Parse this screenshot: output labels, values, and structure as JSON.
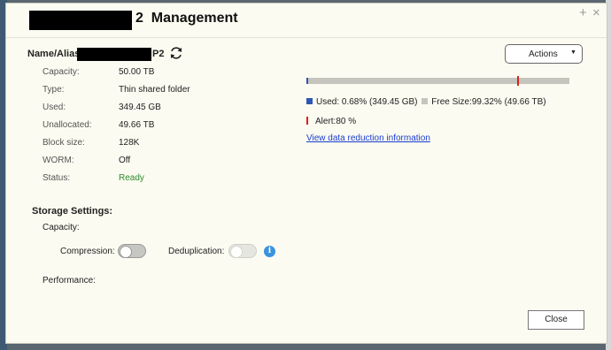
{
  "dialog": {
    "title_suffix": "2  Management",
    "controls": {
      "maximize": "+",
      "close": "×"
    }
  },
  "name_row": {
    "label": "Name/Alias:",
    "suffix": "P2"
  },
  "properties": [
    {
      "label": "Capacity:",
      "value": "50.00 TB"
    },
    {
      "label": "Type:",
      "value": "Thin shared folder"
    },
    {
      "label": "Used:",
      "value": "349.45 GB"
    },
    {
      "label": "Unallocated:",
      "value": "49.66 TB"
    },
    {
      "label": "Block size:",
      "value": "128K"
    },
    {
      "label": "WORM:",
      "value": "Off"
    },
    {
      "label": "Status:",
      "value": "Ready"
    }
  ],
  "actions": {
    "label": "Actions"
  },
  "usage": {
    "used_fraction": 0.0068,
    "alert_fraction": 0.8,
    "used_label": "Used:",
    "used_value": "0.68% (349.45 GB)",
    "free_label": "Free Size:",
    "free_value": "99.32% (49.66 TB)",
    "alert_label": "Alert:",
    "alert_value": "80 %",
    "colors": {
      "used": "#2f56b4",
      "free": "#c5c5bd",
      "alert": "#d9221c"
    }
  },
  "links": {
    "data_reduction": "View data reduction information"
  },
  "storage": {
    "title": "Storage Settings:",
    "capacity_label": "Capacity:",
    "compression_label": "Compression:",
    "compression_on": false,
    "deduplication_label": "Deduplication:",
    "deduplication_on": false,
    "deduplication_enabled": false,
    "performance_label": "Performance:"
  },
  "footer": {
    "close_label": "Close"
  },
  "icons": {
    "refresh": "refresh-icon",
    "info": "info-icon",
    "caret": "chevron-down-icon"
  },
  "status_color": "#2e8b2e"
}
